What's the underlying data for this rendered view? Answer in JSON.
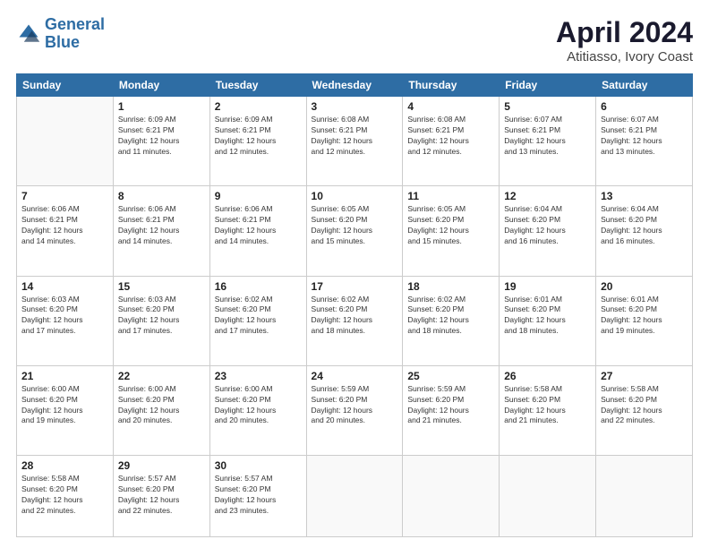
{
  "logo": {
    "line1": "General",
    "line2": "Blue"
  },
  "title": "April 2024",
  "subtitle": "Atitiasso, Ivory Coast",
  "days_of_week": [
    "Sunday",
    "Monday",
    "Tuesday",
    "Wednesday",
    "Thursday",
    "Friday",
    "Saturday"
  ],
  "weeks": [
    [
      {
        "day": "",
        "info": ""
      },
      {
        "day": "1",
        "info": "Sunrise: 6:09 AM\nSunset: 6:21 PM\nDaylight: 12 hours\nand 11 minutes."
      },
      {
        "day": "2",
        "info": "Sunrise: 6:09 AM\nSunset: 6:21 PM\nDaylight: 12 hours\nand 12 minutes."
      },
      {
        "day": "3",
        "info": "Sunrise: 6:08 AM\nSunset: 6:21 PM\nDaylight: 12 hours\nand 12 minutes."
      },
      {
        "day": "4",
        "info": "Sunrise: 6:08 AM\nSunset: 6:21 PM\nDaylight: 12 hours\nand 12 minutes."
      },
      {
        "day": "5",
        "info": "Sunrise: 6:07 AM\nSunset: 6:21 PM\nDaylight: 12 hours\nand 13 minutes."
      },
      {
        "day": "6",
        "info": "Sunrise: 6:07 AM\nSunset: 6:21 PM\nDaylight: 12 hours\nand 13 minutes."
      }
    ],
    [
      {
        "day": "7",
        "info": "Sunrise: 6:06 AM\nSunset: 6:21 PM\nDaylight: 12 hours\nand 14 minutes."
      },
      {
        "day": "8",
        "info": "Sunrise: 6:06 AM\nSunset: 6:21 PM\nDaylight: 12 hours\nand 14 minutes."
      },
      {
        "day": "9",
        "info": "Sunrise: 6:06 AM\nSunset: 6:21 PM\nDaylight: 12 hours\nand 14 minutes."
      },
      {
        "day": "10",
        "info": "Sunrise: 6:05 AM\nSunset: 6:20 PM\nDaylight: 12 hours\nand 15 minutes."
      },
      {
        "day": "11",
        "info": "Sunrise: 6:05 AM\nSunset: 6:20 PM\nDaylight: 12 hours\nand 15 minutes."
      },
      {
        "day": "12",
        "info": "Sunrise: 6:04 AM\nSunset: 6:20 PM\nDaylight: 12 hours\nand 16 minutes."
      },
      {
        "day": "13",
        "info": "Sunrise: 6:04 AM\nSunset: 6:20 PM\nDaylight: 12 hours\nand 16 minutes."
      }
    ],
    [
      {
        "day": "14",
        "info": "Sunrise: 6:03 AM\nSunset: 6:20 PM\nDaylight: 12 hours\nand 17 minutes."
      },
      {
        "day": "15",
        "info": "Sunrise: 6:03 AM\nSunset: 6:20 PM\nDaylight: 12 hours\nand 17 minutes."
      },
      {
        "day": "16",
        "info": "Sunrise: 6:02 AM\nSunset: 6:20 PM\nDaylight: 12 hours\nand 17 minutes."
      },
      {
        "day": "17",
        "info": "Sunrise: 6:02 AM\nSunset: 6:20 PM\nDaylight: 12 hours\nand 18 minutes."
      },
      {
        "day": "18",
        "info": "Sunrise: 6:02 AM\nSunset: 6:20 PM\nDaylight: 12 hours\nand 18 minutes."
      },
      {
        "day": "19",
        "info": "Sunrise: 6:01 AM\nSunset: 6:20 PM\nDaylight: 12 hours\nand 18 minutes."
      },
      {
        "day": "20",
        "info": "Sunrise: 6:01 AM\nSunset: 6:20 PM\nDaylight: 12 hours\nand 19 minutes."
      }
    ],
    [
      {
        "day": "21",
        "info": "Sunrise: 6:00 AM\nSunset: 6:20 PM\nDaylight: 12 hours\nand 19 minutes."
      },
      {
        "day": "22",
        "info": "Sunrise: 6:00 AM\nSunset: 6:20 PM\nDaylight: 12 hours\nand 20 minutes."
      },
      {
        "day": "23",
        "info": "Sunrise: 6:00 AM\nSunset: 6:20 PM\nDaylight: 12 hours\nand 20 minutes."
      },
      {
        "day": "24",
        "info": "Sunrise: 5:59 AM\nSunset: 6:20 PM\nDaylight: 12 hours\nand 20 minutes."
      },
      {
        "day": "25",
        "info": "Sunrise: 5:59 AM\nSunset: 6:20 PM\nDaylight: 12 hours\nand 21 minutes."
      },
      {
        "day": "26",
        "info": "Sunrise: 5:58 AM\nSunset: 6:20 PM\nDaylight: 12 hours\nand 21 minutes."
      },
      {
        "day": "27",
        "info": "Sunrise: 5:58 AM\nSunset: 6:20 PM\nDaylight: 12 hours\nand 22 minutes."
      }
    ],
    [
      {
        "day": "28",
        "info": "Sunrise: 5:58 AM\nSunset: 6:20 PM\nDaylight: 12 hours\nand 22 minutes."
      },
      {
        "day": "29",
        "info": "Sunrise: 5:57 AM\nSunset: 6:20 PM\nDaylight: 12 hours\nand 22 minutes."
      },
      {
        "day": "30",
        "info": "Sunrise: 5:57 AM\nSunset: 6:20 PM\nDaylight: 12 hours\nand 23 minutes."
      },
      {
        "day": "",
        "info": ""
      },
      {
        "day": "",
        "info": ""
      },
      {
        "day": "",
        "info": ""
      },
      {
        "day": "",
        "info": ""
      }
    ]
  ]
}
